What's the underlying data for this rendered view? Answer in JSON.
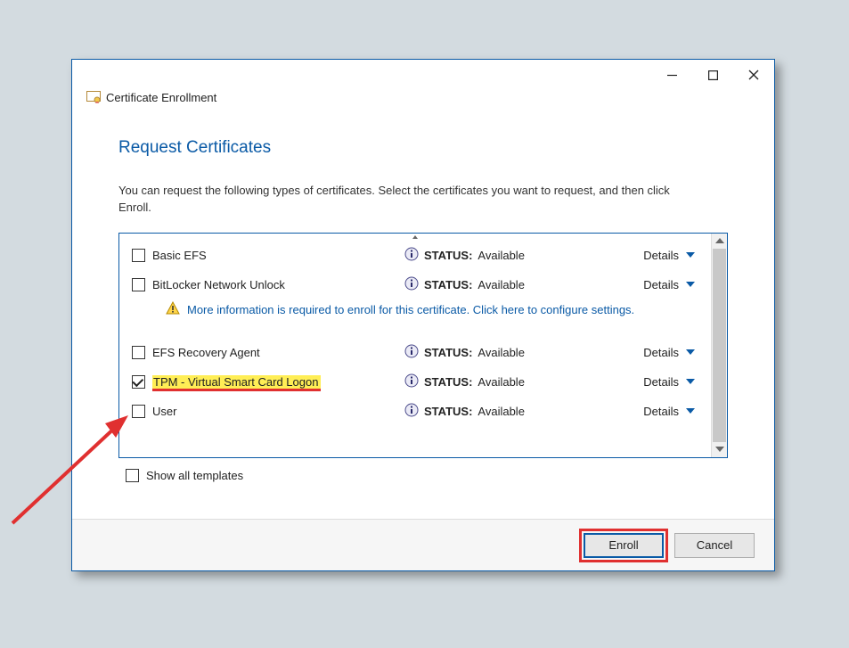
{
  "window": {
    "title": "Certificate Enrollment"
  },
  "page": {
    "heading": "Request Certificates",
    "instructions": "You can request the following types of certificates. Select the certificates you want to request, and then click Enroll."
  },
  "columns": {
    "status_label": "STATUS:",
    "details_label": "Details"
  },
  "certificates": [
    {
      "name": "Basic EFS",
      "checked": false,
      "status": "Available",
      "warn": false,
      "highlight": false
    },
    {
      "name": "BitLocker Network Unlock",
      "checked": false,
      "status": "Available",
      "warn": true,
      "highlight": false
    },
    {
      "name": "EFS Recovery Agent",
      "checked": false,
      "status": "Available",
      "warn": false,
      "highlight": false
    },
    {
      "name": "TPM - Virtual Smart Card Logon",
      "checked": true,
      "status": "Available",
      "warn": false,
      "highlight": true
    },
    {
      "name": "User",
      "checked": false,
      "status": "Available",
      "warn": false,
      "highlight": false
    }
  ],
  "warn_text": "More information is required to enroll for this certificate. Click here to configure settings.",
  "show_all": {
    "label": "Show all templates",
    "checked": false
  },
  "buttons": {
    "enroll": "Enroll",
    "cancel": "Cancel"
  }
}
